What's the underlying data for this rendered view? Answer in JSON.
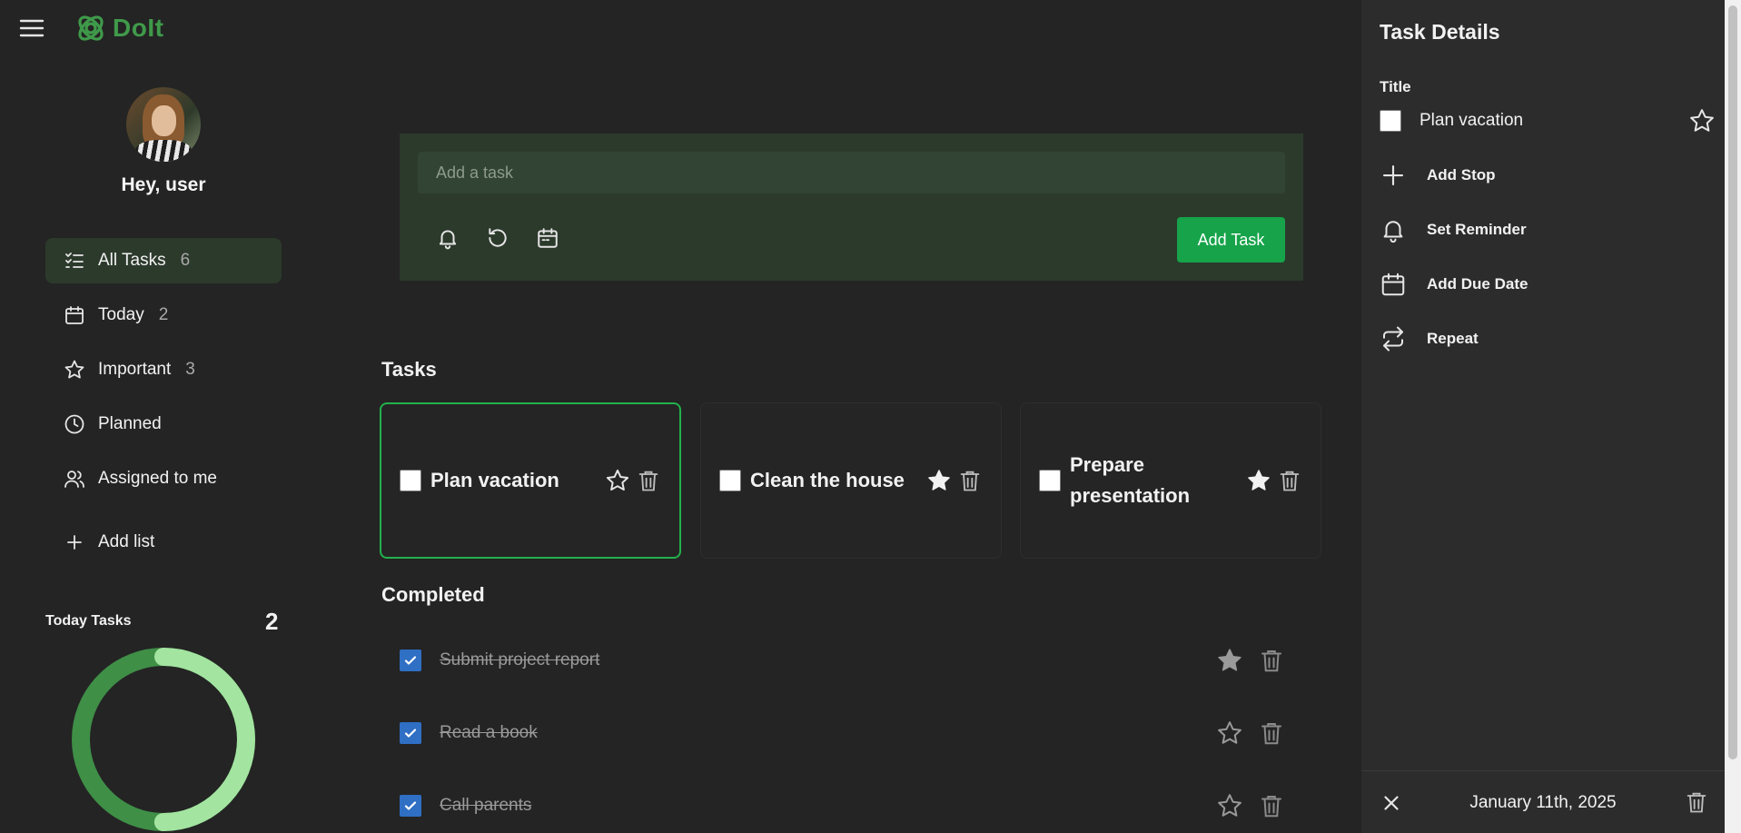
{
  "app": {
    "name": "DoIt",
    "brand_color": "#3f9a4a",
    "accent_color": "#16a34a"
  },
  "profile": {
    "greeting": "Hey, user"
  },
  "sidebar": {
    "items": [
      {
        "label": "All Tasks",
        "count": "6",
        "icon": "list-check-icon",
        "active": true
      },
      {
        "label": "Today",
        "count": "2",
        "icon": "calendar-icon"
      },
      {
        "label": "Important",
        "count": "3",
        "icon": "star-icon"
      },
      {
        "label": "Planned",
        "count": "",
        "icon": "clock-icon"
      },
      {
        "label": "Assigned to me",
        "count": "",
        "icon": "users-icon"
      }
    ],
    "add_list": "Add list",
    "today_tasks": {
      "label": "Today Tasks",
      "count": "2",
      "donut": {
        "completed_fraction": 0.5,
        "colors": [
          "#a3e4a0",
          "#3f8f47"
        ]
      }
    }
  },
  "add_task": {
    "placeholder": "Add a task",
    "button": "Add Task",
    "tools": [
      "bell-icon",
      "repeat-icon",
      "calendar-icon"
    ]
  },
  "tasks": {
    "title": "Tasks",
    "items": [
      {
        "title": "Plan vacation",
        "important": false,
        "selected": true
      },
      {
        "title": "Clean the house",
        "important": true,
        "selected": false
      },
      {
        "title": "Prepare presentation",
        "important": true,
        "selected": false
      }
    ]
  },
  "completed": {
    "title": "Completed",
    "items": [
      {
        "title": "Submit project report",
        "important": true
      },
      {
        "title": "Read a book",
        "important": false
      },
      {
        "title": "Call parents",
        "important": false
      }
    ]
  },
  "details": {
    "heading": "Task Details",
    "title_label": "Title",
    "task_name": "Plan vacation",
    "actions": {
      "add_stop": "Add Stop",
      "set_reminder": "Set Reminder",
      "add_due_date": "Add Due Date",
      "repeat": "Repeat"
    },
    "footer_date": "January 11th, 2025"
  }
}
